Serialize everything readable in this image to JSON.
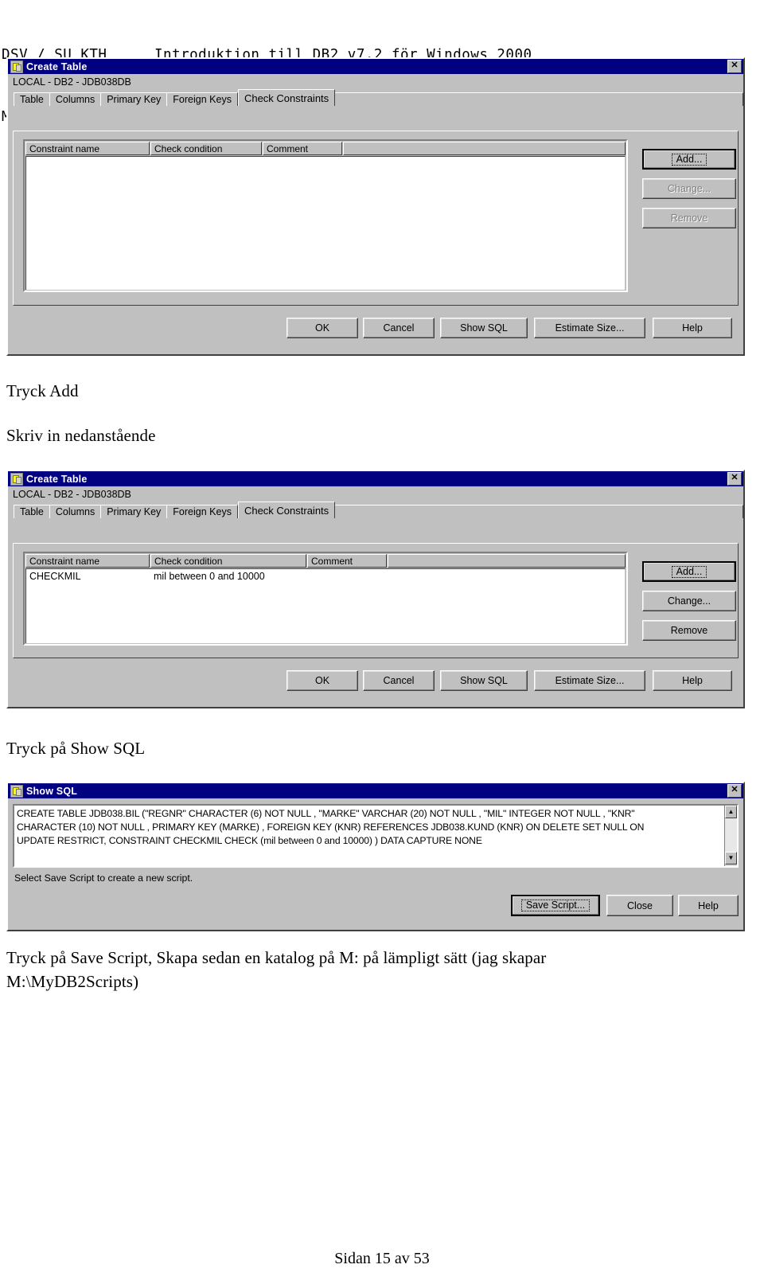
{
  "document": {
    "header_left": "DSV / SU KTH",
    "header_title": "Introduktion till DB2 v7.2 för Windows 2000",
    "header_author": "M.Persson",
    "footer": "Sidan 15 av 53"
  },
  "captions": {
    "caption1": "Tryck Add",
    "caption2": "Skriv in nedanstående",
    "caption3": "Tryck på Show SQL",
    "caption4_line1": "Tryck på Save Script, Skapa sedan en katalog på M: på lämpligt sätt (jag skapar",
    "caption4_line2": "M:\\MyDB2Scripts)"
  },
  "dialog1": {
    "title": "Create Table",
    "icon": "table-icon",
    "close_label": "✕",
    "subtitle": "LOCAL - DB2 - JDB038DB",
    "tabs": [
      {
        "label": "Table",
        "selected": false
      },
      {
        "label": "Columns",
        "selected": false
      },
      {
        "label": "Primary Key",
        "selected": false
      },
      {
        "label": "Foreign Keys",
        "selected": false
      },
      {
        "label": "Check Constraints",
        "selected": true
      }
    ],
    "grid": {
      "columns": [
        "Constraint name",
        "Check condition",
        "Comment"
      ],
      "rows": []
    },
    "side_buttons": [
      {
        "label": "Add...",
        "enabled": true,
        "focused": true
      },
      {
        "label": "Change...",
        "enabled": false,
        "focused": false
      },
      {
        "label": "Remove",
        "enabled": false,
        "focused": false
      }
    ],
    "bottom_buttons": [
      {
        "label": "OK",
        "mnemonic": "O"
      },
      {
        "label": "Cancel",
        "mnemonic": ""
      },
      {
        "label": "Show SQL",
        "mnemonic": "S"
      },
      {
        "label": "Estimate Size...",
        "mnemonic": "E"
      },
      {
        "label": "Help",
        "mnemonic": ""
      }
    ]
  },
  "dialog2": {
    "title": "Create Table",
    "icon": "table-icon",
    "close_label": "✕",
    "subtitle": "LOCAL - DB2 - JDB038DB",
    "tabs": [
      {
        "label": "Table",
        "selected": false
      },
      {
        "label": "Columns",
        "selected": false
      },
      {
        "label": "Primary Key",
        "selected": false
      },
      {
        "label": "Foreign Keys",
        "selected": false
      },
      {
        "label": "Check Constraints",
        "selected": true
      }
    ],
    "grid": {
      "columns": [
        "Constraint name",
        "Check condition",
        "Comment"
      ],
      "rows": [
        {
          "constraint_name": "CHECKMIL",
          "check_condition": "mil between 0 and 10000",
          "comment": ""
        }
      ]
    },
    "side_buttons": [
      {
        "label": "Add...",
        "enabled": true,
        "focused": true
      },
      {
        "label": "Change...",
        "enabled": true,
        "focused": false
      },
      {
        "label": "Remove",
        "enabled": true,
        "focused": false
      }
    ],
    "bottom_buttons": [
      {
        "label": "OK",
        "mnemonic": "O"
      },
      {
        "label": "Cancel",
        "mnemonic": ""
      },
      {
        "label": "Show SQL",
        "mnemonic": "S"
      },
      {
        "label": "Estimate Size...",
        "mnemonic": "E"
      },
      {
        "label": "Help",
        "mnemonic": ""
      }
    ]
  },
  "dialog3": {
    "title": "Show SQL",
    "icon": "table-icon",
    "close_label": "✕",
    "sql_lines": [
      "CREATE TABLE JDB038.BIL (\"REGNR\" CHARACTER (6)  NOT NULL , \"MARKE\" VARCHAR (20)  NOT NULL , \"MIL\" INTEGER  NOT NULL , \"KNR\"",
      "CHARACTER (10)  NOT NULL , PRIMARY KEY (MARKE) ,  FOREIGN KEY (KNR) REFERENCES JDB038.KUND (KNR) ON DELETE SET NULL ON",
      "UPDATE RESTRICT,  CONSTRAINT CHECKMIL CHECK (mil between 0 and 10000) )  DATA CAPTURE NONE"
    ],
    "status": "Select Save Script to create a new script.",
    "buttons": [
      {
        "label": "Save Script...",
        "mnemonic": "",
        "focused": true
      },
      {
        "label": "Close",
        "mnemonic": "",
        "focused": false
      },
      {
        "label": "Help",
        "mnemonic": "",
        "focused": false
      }
    ],
    "scroll_up": "▲",
    "scroll_down": "▼"
  },
  "colors": {
    "titlebar": "#000080",
    "dialog_face": "#c0c0c0",
    "field_bg": "#ffffff",
    "disabled_text": "#808080"
  }
}
